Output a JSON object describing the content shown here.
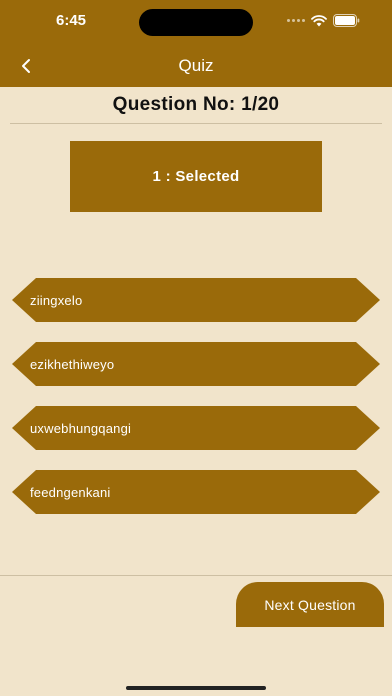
{
  "status_bar": {
    "time": "6:45"
  },
  "nav": {
    "title": "Quiz"
  },
  "question": {
    "number_label": "Question No: 1/20",
    "selected_label": "1 : Selected"
  },
  "options": [
    {
      "label": "ziingxelo"
    },
    {
      "label": "ezikhethiweyo"
    },
    {
      "label": "uxwebhungqangi"
    },
    {
      "label": "feedngenkani"
    }
  ],
  "footer": {
    "next_label": "Next Question"
  },
  "colors": {
    "primary": "#9a6a0a",
    "background": "#f1e4cb",
    "text_dark": "#111111",
    "text_light": "#ffffff"
  }
}
